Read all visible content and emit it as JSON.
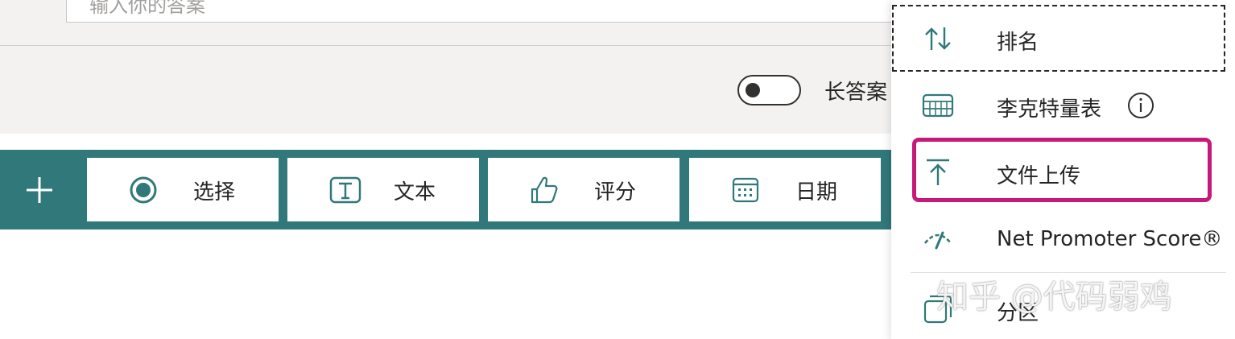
{
  "question": {
    "answer_placeholder": "输入你的答案",
    "long_answer_label": "长答案",
    "long_answer_enabled": false
  },
  "type_bar": {
    "accent_color": "#31787a",
    "add_icon": "plus-icon",
    "items": [
      {
        "label": "选择",
        "icon": "radio-icon"
      },
      {
        "label": "文本",
        "icon": "text-icon"
      },
      {
        "label": "评分",
        "icon": "thumbs-up-icon"
      },
      {
        "label": "日期",
        "icon": "calendar-icon"
      }
    ]
  },
  "menu": {
    "items": [
      {
        "label": "排名",
        "icon": "ranking-icon",
        "focused": true
      },
      {
        "label": "李克特量表",
        "icon": "likert-icon",
        "info_icon": "info-icon"
      },
      {
        "label": "文件上传",
        "icon": "upload-icon",
        "highlighted": true
      },
      {
        "label": "Net Promoter Score®",
        "icon": "nps-gauge-icon"
      },
      {
        "label": "分区",
        "icon": "section-icon"
      }
    ],
    "highlight_color": "#c7197a"
  },
  "watermark": "知乎 @代码弱鸡"
}
